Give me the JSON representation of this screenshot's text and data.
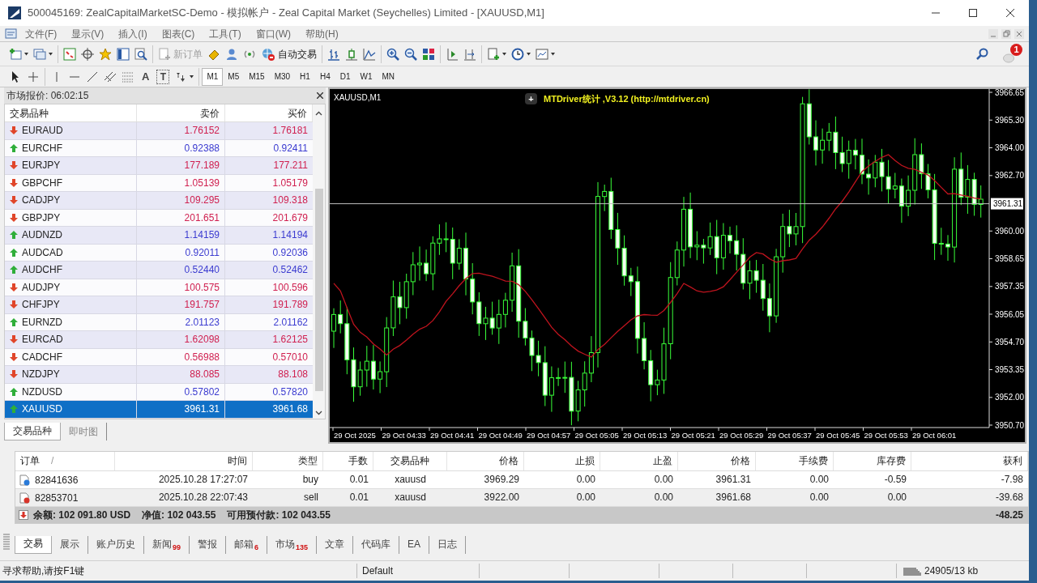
{
  "window": {
    "title": "500045169: ZealCapitalMarketSC-Demo - 模拟帐户 - Zeal Capital Market (Seychelles) Limited - [XAUUSD,M1]"
  },
  "menu": [
    "文件(F)",
    "显示(V)",
    "插入(I)",
    "图表(C)",
    "工具(T)",
    "窗口(W)",
    "帮助(H)"
  ],
  "toolbar": {
    "new_order": {
      "label": "新订单",
      "disabled": true
    },
    "auto_trading": {
      "label": "自动交易"
    },
    "notification_count": "1"
  },
  "drawing_tools": {
    "text_tool": "A",
    "label_tool": "T"
  },
  "timeframes": [
    {
      "label": "M1",
      "selected": true
    },
    {
      "label": "M5",
      "selected": false
    },
    {
      "label": "M15",
      "selected": false
    },
    {
      "label": "M30",
      "selected": false
    },
    {
      "label": "H1",
      "selected": false
    },
    {
      "label": "H4",
      "selected": false
    },
    {
      "label": "D1",
      "selected": false
    },
    {
      "label": "W1",
      "selected": false
    },
    {
      "label": "MN",
      "selected": false
    }
  ],
  "market_watch": {
    "title": "市场报价: 06:02:15",
    "columns": [
      "交易品种",
      "卖价",
      "买价"
    ],
    "rows": [
      {
        "symbol": "EURAUD",
        "bid": "1.76152",
        "ask": "1.76181",
        "rising": false,
        "selected": false
      },
      {
        "symbol": "EURCHF",
        "bid": "0.92388",
        "ask": "0.92411",
        "rising": true,
        "selected": false
      },
      {
        "symbol": "EURJPY",
        "bid": "177.189",
        "ask": "177.211",
        "rising": false,
        "selected": false
      },
      {
        "symbol": "GBPCHF",
        "bid": "1.05139",
        "ask": "1.05179",
        "rising": false,
        "selected": false
      },
      {
        "symbol": "CADJPY",
        "bid": "109.295",
        "ask": "109.318",
        "rising": false,
        "selected": false
      },
      {
        "symbol": "GBPJPY",
        "bid": "201.651",
        "ask": "201.679",
        "rising": false,
        "selected": false
      },
      {
        "symbol": "AUDNZD",
        "bid": "1.14159",
        "ask": "1.14194",
        "rising": true,
        "selected": false
      },
      {
        "symbol": "AUDCAD",
        "bid": "0.92011",
        "ask": "0.92036",
        "rising": true,
        "selected": false
      },
      {
        "symbol": "AUDCHF",
        "bid": "0.52440",
        "ask": "0.52462",
        "rising": true,
        "selected": false
      },
      {
        "symbol": "AUDJPY",
        "bid": "100.575",
        "ask": "100.596",
        "rising": false,
        "selected": false
      },
      {
        "symbol": "CHFJPY",
        "bid": "191.757",
        "ask": "191.789",
        "rising": false,
        "selected": false
      },
      {
        "symbol": "EURNZD",
        "bid": "2.01123",
        "ask": "2.01162",
        "rising": true,
        "selected": false
      },
      {
        "symbol": "EURCAD",
        "bid": "1.62098",
        "ask": "1.62125",
        "rising": false,
        "selected": false
      },
      {
        "symbol": "CADCHF",
        "bid": "0.56988",
        "ask": "0.57010",
        "rising": false,
        "selected": false
      },
      {
        "symbol": "NZDJPY",
        "bid": "88.085",
        "ask": "88.108",
        "rising": false,
        "selected": false
      },
      {
        "symbol": "NZDUSD",
        "bid": "0.57802",
        "ask": "0.57820",
        "rising": true,
        "selected": false
      },
      {
        "symbol": "XAUUSD",
        "bid": "3961.31",
        "ask": "3961.68",
        "rising": true,
        "selected": true
      }
    ],
    "tabs": [
      {
        "label": "交易品种",
        "selected": true
      },
      {
        "label": "即时图",
        "selected": false
      }
    ]
  },
  "chart": {
    "title": "XAUUSD,M1",
    "indicator": {
      "button": "+",
      "label": "MTDriver统计 ,V3.12 (http://mtdriver.cn)"
    },
    "price_labels": [
      "3966.65",
      "3965.30",
      "3964.00",
      "3962.70",
      "3960.00",
      "3958.65",
      "3957.35",
      "3956.05",
      "3954.70",
      "3953.35",
      "3952.00",
      "3950.70"
    ],
    "current_price": "3961.31",
    "time_labels": [
      "29 Oct 2025",
      "29 Oct 04:33",
      "29 Oct 04:41",
      "29 Oct 04:49",
      "29 Oct 04:57",
      "29 Oct 05:05",
      "29 Oct 05:13",
      "29 Oct 05:21",
      "29 Oct 05:29",
      "29 Oct 05:37",
      "29 Oct 05:45",
      "29 Oct 05:53",
      "29 Oct 06:01"
    ]
  },
  "terminal": {
    "columns": [
      "订单",
      "时间",
      "类型",
      "手数",
      "交易品种",
      "价格",
      "止损",
      "止盈",
      "价格",
      "手续费",
      "库存费",
      "获利"
    ],
    "sort_mark": "/",
    "orders": [
      {
        "kind": "buy",
        "cells": [
          "82841636",
          "2025.10.28 17:27:07",
          "buy",
          "0.01",
          "xauusd",
          "3969.29",
          "0.00",
          "0.00",
          "3961.31",
          "0.00",
          "-0.59",
          "-7.98"
        ]
      },
      {
        "kind": "sell",
        "cells": [
          "82853701",
          "2025.10.28 22:07:43",
          "sell",
          "0.01",
          "xauusd",
          "3922.00",
          "0.00",
          "0.00",
          "3961.68",
          "0.00",
          "0.00",
          "-39.68"
        ]
      }
    ],
    "summary": {
      "balance": "余额: 102 091.80 USD",
      "equity": "净值: 102 043.55",
      "free_margin": "可用预付款: 102 043.55",
      "profit": "-48.25"
    },
    "tabs": [
      {
        "label": "交易",
        "selected": true
      },
      {
        "label": "展示",
        "selected": false
      },
      {
        "label": "账户历史",
        "selected": false
      },
      {
        "label": "新闻",
        "badge": "99",
        "selected": false
      },
      {
        "label": "警报",
        "selected": false
      },
      {
        "label": "邮箱",
        "badge": "6",
        "selected": false
      },
      {
        "label": "市场",
        "badge": "135",
        "selected": false
      },
      {
        "label": "文章",
        "selected": false
      },
      {
        "label": "代码库",
        "selected": false
      },
      {
        "label": "EA",
        "selected": false
      },
      {
        "label": "日志",
        "selected": false
      }
    ]
  },
  "status_bar": {
    "help": "寻求帮助,请按F1键",
    "profile": "Default",
    "traffic": "24905/13 kb"
  }
}
